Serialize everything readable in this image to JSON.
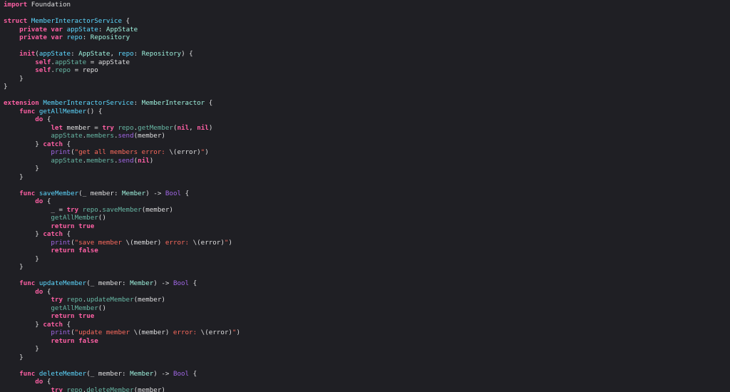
{
  "editor": {
    "language": "Swift",
    "theme_colors": {
      "background": "#1f1f24",
      "plain": "#dfdfe0",
      "keyword": "#fc5fa3",
      "type": "#9ef1dd",
      "property": "#67b7a4",
      "declaration": "#5dd8ff",
      "string": "#fc6a5d",
      "other": "#a167e6"
    },
    "lines": [
      [
        [
          "kw",
          "import"
        ],
        [
          "plain",
          " Foundation"
        ]
      ],
      [],
      [
        [
          "kw",
          "struct"
        ],
        [
          "plain",
          " "
        ],
        [
          "decl",
          "MemberInteractorService"
        ],
        [
          "plain",
          " {"
        ]
      ],
      [
        [
          "plain",
          "    "
        ],
        [
          "kw",
          "private"
        ],
        [
          "plain",
          " "
        ],
        [
          "kw",
          "var"
        ],
        [
          "plain",
          " "
        ],
        [
          "decl",
          "appState"
        ],
        [
          "plain",
          ": "
        ],
        [
          "type",
          "AppState"
        ]
      ],
      [
        [
          "plain",
          "    "
        ],
        [
          "kw",
          "private"
        ],
        [
          "plain",
          " "
        ],
        [
          "kw",
          "var"
        ],
        [
          "plain",
          " "
        ],
        [
          "decl",
          "repo"
        ],
        [
          "plain",
          ": "
        ],
        [
          "type",
          "Repository"
        ]
      ],
      [],
      [
        [
          "plain",
          "    "
        ],
        [
          "kw",
          "init"
        ],
        [
          "plain",
          "("
        ],
        [
          "decl",
          "appState"
        ],
        [
          "plain",
          ": "
        ],
        [
          "type",
          "AppState"
        ],
        [
          "plain",
          ", "
        ],
        [
          "decl",
          "repo"
        ],
        [
          "plain",
          ": "
        ],
        [
          "type",
          "Repository"
        ],
        [
          "plain",
          ") {"
        ]
      ],
      [
        [
          "plain",
          "        "
        ],
        [
          "kw",
          "self"
        ],
        [
          "plain",
          "."
        ],
        [
          "prop",
          "appState"
        ],
        [
          "plain",
          " = appState"
        ]
      ],
      [
        [
          "plain",
          "        "
        ],
        [
          "kw",
          "self"
        ],
        [
          "plain",
          "."
        ],
        [
          "prop",
          "repo"
        ],
        [
          "plain",
          " = repo"
        ]
      ],
      [
        [
          "plain",
          "    }"
        ]
      ],
      [
        [
          "plain",
          "}"
        ]
      ],
      [],
      [
        [
          "kw",
          "extension"
        ],
        [
          "plain",
          " "
        ],
        [
          "decl",
          "MemberInteractorService"
        ],
        [
          "plain",
          ": "
        ],
        [
          "type",
          "MemberInteractor"
        ],
        [
          "plain",
          " {"
        ]
      ],
      [
        [
          "plain",
          "    "
        ],
        [
          "kw",
          "func"
        ],
        [
          "plain",
          " "
        ],
        [
          "decl",
          "getAllMember"
        ],
        [
          "plain",
          "() {"
        ]
      ],
      [
        [
          "plain",
          "        "
        ],
        [
          "kw",
          "do"
        ],
        [
          "plain",
          " {"
        ]
      ],
      [
        [
          "plain",
          "            "
        ],
        [
          "kw",
          "let"
        ],
        [
          "plain",
          " member = "
        ],
        [
          "kw",
          "try"
        ],
        [
          "plain",
          " "
        ],
        [
          "prop",
          "repo"
        ],
        [
          "plain",
          "."
        ],
        [
          "fn",
          "getMember"
        ],
        [
          "plain",
          "("
        ],
        [
          "kw",
          "nil"
        ],
        [
          "plain",
          ", "
        ],
        [
          "kw",
          "nil"
        ],
        [
          "plain",
          ")"
        ]
      ],
      [
        [
          "plain",
          "            "
        ],
        [
          "prop",
          "appState"
        ],
        [
          "plain",
          "."
        ],
        [
          "prop",
          "members"
        ],
        [
          "plain",
          "."
        ],
        [
          "other",
          "send"
        ],
        [
          "plain",
          "(member)"
        ]
      ],
      [
        [
          "plain",
          "        } "
        ],
        [
          "kw",
          "catch"
        ],
        [
          "plain",
          " {"
        ]
      ],
      [
        [
          "plain",
          "            "
        ],
        [
          "other",
          "print"
        ],
        [
          "plain",
          "("
        ],
        [
          "str",
          "\"get all members error: "
        ],
        [
          "plain",
          "\\(error)"
        ],
        [
          "str",
          "\""
        ],
        [
          "plain",
          ")"
        ]
      ],
      [
        [
          "plain",
          "            "
        ],
        [
          "prop",
          "appState"
        ],
        [
          "plain",
          "."
        ],
        [
          "prop",
          "members"
        ],
        [
          "plain",
          "."
        ],
        [
          "other",
          "send"
        ],
        [
          "plain",
          "("
        ],
        [
          "kw",
          "nil"
        ],
        [
          "plain",
          ")"
        ]
      ],
      [
        [
          "plain",
          "        }"
        ]
      ],
      [
        [
          "plain",
          "    }"
        ]
      ],
      [],
      [
        [
          "plain",
          "    "
        ],
        [
          "kw",
          "func"
        ],
        [
          "plain",
          " "
        ],
        [
          "decl",
          "saveMember"
        ],
        [
          "plain",
          "(_ member: "
        ],
        [
          "type",
          "Member"
        ],
        [
          "plain",
          ") -> "
        ],
        [
          "other",
          "Bool"
        ],
        [
          "plain",
          " {"
        ]
      ],
      [
        [
          "plain",
          "        "
        ],
        [
          "kw",
          "do"
        ],
        [
          "plain",
          " {"
        ]
      ],
      [
        [
          "plain",
          "            _ = "
        ],
        [
          "kw",
          "try"
        ],
        [
          "plain",
          " "
        ],
        [
          "prop",
          "repo"
        ],
        [
          "plain",
          "."
        ],
        [
          "fn",
          "saveMember"
        ],
        [
          "plain",
          "(member)"
        ]
      ],
      [
        [
          "plain",
          "            "
        ],
        [
          "fn",
          "getAllMember"
        ],
        [
          "plain",
          "()"
        ]
      ],
      [
        [
          "plain",
          "            "
        ],
        [
          "kw",
          "return"
        ],
        [
          "plain",
          " "
        ],
        [
          "kw",
          "true"
        ]
      ],
      [
        [
          "plain",
          "        } "
        ],
        [
          "kw",
          "catch"
        ],
        [
          "plain",
          " {"
        ]
      ],
      [
        [
          "plain",
          "            "
        ],
        [
          "other",
          "print"
        ],
        [
          "plain",
          "("
        ],
        [
          "str",
          "\"save member "
        ],
        [
          "plain",
          "\\(member)"
        ],
        [
          "str",
          " error: "
        ],
        [
          "plain",
          "\\(error)"
        ],
        [
          "str",
          "\""
        ],
        [
          "plain",
          ")"
        ]
      ],
      [
        [
          "plain",
          "            "
        ],
        [
          "kw",
          "return"
        ],
        [
          "plain",
          " "
        ],
        [
          "kw",
          "false"
        ]
      ],
      [
        [
          "plain",
          "        }"
        ]
      ],
      [
        [
          "plain",
          "    }"
        ]
      ],
      [],
      [
        [
          "plain",
          "    "
        ],
        [
          "kw",
          "func"
        ],
        [
          "plain",
          " "
        ],
        [
          "decl",
          "updateMember"
        ],
        [
          "plain",
          "(_ member: "
        ],
        [
          "type",
          "Member"
        ],
        [
          "plain",
          ") -> "
        ],
        [
          "other",
          "Bool"
        ],
        [
          "plain",
          " {"
        ]
      ],
      [
        [
          "plain",
          "        "
        ],
        [
          "kw",
          "do"
        ],
        [
          "plain",
          " {"
        ]
      ],
      [
        [
          "plain",
          "            "
        ],
        [
          "kw",
          "try"
        ],
        [
          "plain",
          " "
        ],
        [
          "prop",
          "repo"
        ],
        [
          "plain",
          "."
        ],
        [
          "fn",
          "updateMember"
        ],
        [
          "plain",
          "(member)"
        ]
      ],
      [
        [
          "plain",
          "            "
        ],
        [
          "fn",
          "getAllMember"
        ],
        [
          "plain",
          "()"
        ]
      ],
      [
        [
          "plain",
          "            "
        ],
        [
          "kw",
          "return"
        ],
        [
          "plain",
          " "
        ],
        [
          "kw",
          "true"
        ]
      ],
      [
        [
          "plain",
          "        } "
        ],
        [
          "kw",
          "catch"
        ],
        [
          "plain",
          " {"
        ]
      ],
      [
        [
          "plain",
          "            "
        ],
        [
          "other",
          "print"
        ],
        [
          "plain",
          "("
        ],
        [
          "str",
          "\"update member "
        ],
        [
          "plain",
          "\\(member)"
        ],
        [
          "str",
          " error: "
        ],
        [
          "plain",
          "\\(error)"
        ],
        [
          "str",
          "\""
        ],
        [
          "plain",
          ")"
        ]
      ],
      [
        [
          "plain",
          "            "
        ],
        [
          "kw",
          "return"
        ],
        [
          "plain",
          " "
        ],
        [
          "kw",
          "false"
        ]
      ],
      [
        [
          "plain",
          "        }"
        ]
      ],
      [
        [
          "plain",
          "    }"
        ]
      ],
      [],
      [
        [
          "plain",
          "    "
        ],
        [
          "kw",
          "func"
        ],
        [
          "plain",
          " "
        ],
        [
          "decl",
          "deleteMember"
        ],
        [
          "plain",
          "(_ member: "
        ],
        [
          "type",
          "Member"
        ],
        [
          "plain",
          ") -> "
        ],
        [
          "other",
          "Bool"
        ],
        [
          "plain",
          " {"
        ]
      ],
      [
        [
          "plain",
          "        "
        ],
        [
          "kw",
          "do"
        ],
        [
          "plain",
          " {"
        ]
      ],
      [
        [
          "plain",
          "            "
        ],
        [
          "kw",
          "try"
        ],
        [
          "plain",
          " "
        ],
        [
          "prop",
          "repo"
        ],
        [
          "plain",
          "."
        ],
        [
          "fn",
          "deleteMember"
        ],
        [
          "plain",
          "(member)"
        ]
      ]
    ]
  }
}
